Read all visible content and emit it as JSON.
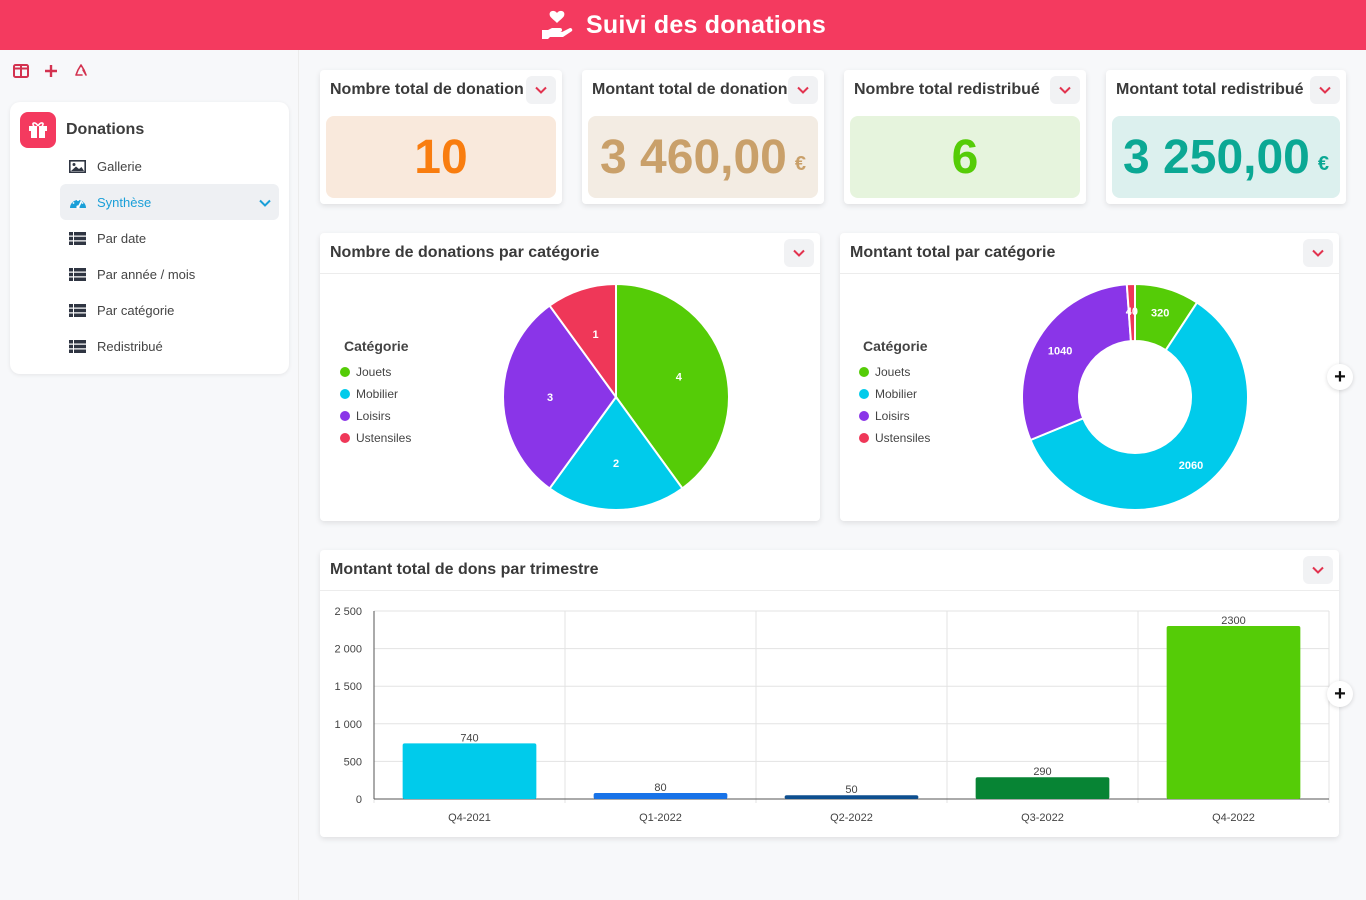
{
  "header": {
    "title": "Suivi des donations",
    "icon": "hand-heart-icon"
  },
  "sidebar": {
    "tools": [
      {
        "name": "panel-toggle-icon"
      },
      {
        "name": "add-icon"
      },
      {
        "name": "recycle-icon"
      }
    ],
    "section_label": "Donations",
    "items": [
      {
        "label": "Gallerie",
        "icon": "image-icon"
      },
      {
        "label": "Synthèse",
        "icon": "dashboard-icon",
        "active": true
      },
      {
        "label": "Par date",
        "icon": "table-icon"
      },
      {
        "label": "Par année / mois",
        "icon": "table-icon"
      },
      {
        "label": "Par catégorie",
        "icon": "table-icon"
      },
      {
        "label": "Redistribué",
        "icon": "table-icon"
      }
    ]
  },
  "kpis": [
    {
      "title": "Nombre total de donation",
      "value": "10",
      "currency": "",
      "color": "#f97d0f",
      "bg": "#f9e9dc"
    },
    {
      "title": "Montant total de donation",
      "value": "3 460,00",
      "currency": "€",
      "color": "#c9a06a",
      "bg": "#f3ece3"
    },
    {
      "title": "Nombre total redistribué",
      "value": "6",
      "currency": "",
      "color": "#55cc07",
      "bg": "#e6f4dd"
    },
    {
      "title": "Montant total redistribué",
      "value": "3 250,00",
      "currency": "€",
      "color": "#0ba894",
      "bg": "#dcf0ee"
    }
  ],
  "pie_card": {
    "title": "Nombre de donations par catégorie",
    "legend_title": "Catégorie"
  },
  "donut_card": {
    "title": "Montant total par catégorie",
    "legend_title": "Catégorie"
  },
  "bar_card": {
    "title": "Montant total de dons par trimestre"
  },
  "chart_data": [
    {
      "type": "pie",
      "categories": [
        "Jouets",
        "Mobilier",
        "Loisirs",
        "Ustensiles"
      ],
      "values": [
        4,
        2,
        3,
        1
      ],
      "colors": [
        "#55cc07",
        "#00cbeb",
        "#8a35e8",
        "#ef3758"
      ]
    },
    {
      "type": "pie",
      "categories": [
        "Jouets",
        "Mobilier",
        "Loisirs",
        "Ustensiles"
      ],
      "values": [
        320,
        2060,
        1040,
        40
      ],
      "colors": [
        "#55cc07",
        "#00cbeb",
        "#8a35e8",
        "#ef3758"
      ]
    },
    {
      "type": "bar",
      "categories": [
        "Q4-2021",
        "Q1-2022",
        "Q2-2022",
        "Q3-2022",
        "Q4-2022"
      ],
      "values": [
        740,
        80,
        50,
        290,
        2300
      ],
      "colors": [
        "#00cbeb",
        "#1873e8",
        "#0e4f8f",
        "#078434",
        "#55cc07"
      ],
      "ylim": [
        0,
        2500
      ],
      "yticks": [
        "0",
        "500",
        "1 000",
        "1 500",
        "2 000",
        "2 500"
      ],
      "grid": true
    }
  ]
}
